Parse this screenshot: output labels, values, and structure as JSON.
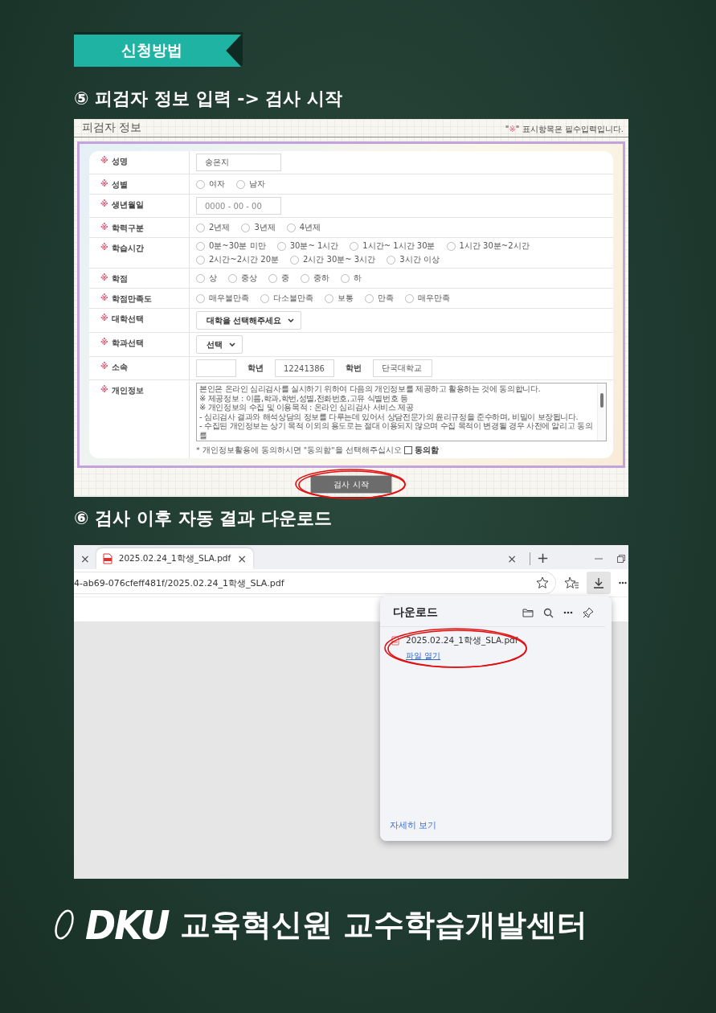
{
  "badge": "신청방법",
  "sections": [
    {
      "kind": "form",
      "heading": "⑤ 피검자 정보 입력 -> 검사 시작",
      "screen": {
        "title": "피검자 정보",
        "note": {
          "before": "\"",
          "mark": "※",
          "after": "\" 표시항목은 필수입력입니다."
        },
        "rows": [
          {
            "kind": "text",
            "mark": "※",
            "label": "성명",
            "value": "송은지"
          },
          {
            "kind": "radio",
            "mark": "※",
            "label": "성별",
            "options": [
              {
                "label": "여자",
                "selected": false
              },
              {
                "label": "남자",
                "selected": false
              }
            ]
          },
          {
            "kind": "text",
            "mark": "※",
            "label": "생년월일",
            "placeholder": "0000 - 00 - 00"
          },
          {
            "kind": "radio",
            "mark": "※",
            "label": "학력구분",
            "options": [
              {
                "label": "2년제",
                "selected": false
              },
              {
                "label": "3년제",
                "selected": false
              },
              {
                "label": "4년제",
                "selected": false
              }
            ]
          },
          {
            "kind": "radio",
            "mark": "※",
            "label": "학습시간",
            "options": [
              {
                "label": "0분~30분 미만",
                "selected": false
              },
              {
                "label": "30분~ 1시간",
                "selected": false
              },
              {
                "label": "1시간~ 1시간 30분",
                "selected": false
              },
              {
                "label": "1시간 30분~2시간",
                "selected": false
              },
              {
                "label": "2시간~2시간 20분",
                "selected": false
              },
              {
                "label": "2시간 30분~ 3시간",
                "selected": false
              },
              {
                "label": "3시간 이상",
                "selected": false
              }
            ]
          },
          {
            "kind": "radio",
            "mark": "※",
            "label": "학점",
            "options": [
              {
                "label": "상",
                "selected": false
              },
              {
                "label": "중상",
                "selected": false
              },
              {
                "label": "중",
                "selected": false
              },
              {
                "label": "중하",
                "selected": false
              },
              {
                "label": "하",
                "selected": false
              }
            ]
          },
          {
            "kind": "radio",
            "mark": "※",
            "label": "학점만족도",
            "options": [
              {
                "label": "매우불만족",
                "selected": false
              },
              {
                "label": "다소불만족",
                "selected": false
              },
              {
                "label": "보통",
                "selected": false
              },
              {
                "label": "만족",
                "selected": false
              },
              {
                "label": "매우만족",
                "selected": false
              }
            ]
          },
          {
            "kind": "select",
            "mark": "※",
            "label": "대학선택",
            "value": "대학을 선택해주세요"
          },
          {
            "kind": "select",
            "mark": "※",
            "label": "학과선택",
            "value": "선택"
          },
          {
            "kind": "affiliation",
            "mark": "※",
            "label": "소속",
            "items": [
              {
                "kind": "field"
              },
              {
                "kind": "label",
                "text": "학년"
              },
              {
                "kind": "field",
                "value": "12241386"
              },
              {
                "kind": "label",
                "text": "학번"
              },
              {
                "kind": "field",
                "value": "단국대학교"
              }
            ]
          },
          {
            "kind": "consent",
            "mark": "※",
            "label": "개인정보",
            "lines": [
              "본인은 온라인 심리검사를 실시하기 위하여 다음의 개인정보를 제공하고 활용하는 것에 동의합니다.",
              "※ 제공정보 : 이름,학과,학번,성별,전화번호,고유 식별번호 등",
              "※ 개인정보의 수집 및 이용목적 : 온라인 심리검사 서비스 제공",
              "- 심리검사 결과와 해석상담의 정보를 다루는데 있어서 상담전문가의 윤리규정을 준수하며, 비밀이 보장됩니다.",
              "- 수집된 개인정보는 상기 목적 이외의 용도로는 절대 이용되지 않으며 수집 목적이 변경될 경우 사전에 알리고 동의를"
            ],
            "hint": "* 개인정보활용에 동의하시면 \"동의함\"을 선택해주십시오",
            "checkbox": {
              "label": "동의함",
              "checked": false
            }
          }
        ],
        "submit": {
          "label": "검사 시작",
          "annotated": true
        }
      }
    },
    {
      "kind": "browser",
      "heading": "⑥ 검사 이후 자동 결과 다운로드",
      "screen": {
        "tabs": [
          {
            "close": "×",
            "selected": false
          },
          {
            "title": "2025.02.24_1학생_SLA.pdf",
            "close": "×",
            "selected": true
          },
          {
            "close": "×",
            "selected": false
          }
        ],
        "new_tab": "+",
        "address": "4-ab69-076cfeff481f/2025.02.24_1학생_SLA.pdf",
        "downloads": {
          "title": "다운로드",
          "items": [
            {
              "file": "2025.02.24_1학생_SLA.pdf",
              "action": "파일 열기",
              "annotated": true
            }
          ],
          "footer": "자세히 보기"
        }
      }
    }
  ],
  "footer": {
    "logo": "DKU",
    "name": "교육혁신원 교수학습개발센터"
  }
}
